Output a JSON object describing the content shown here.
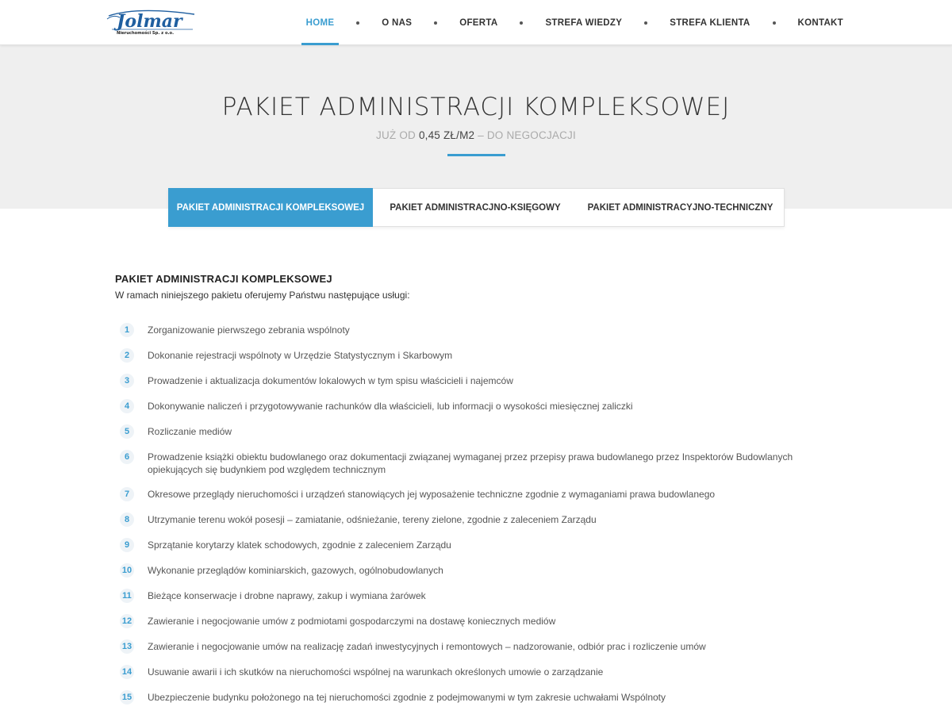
{
  "brand": {
    "name": "Jolmar",
    "tagline": "Nieruchomości Sp. z o.o."
  },
  "nav": {
    "items": [
      "HOME",
      "O NAS",
      "OFERTA",
      "STREFA WIEDZY",
      "STREFA KLIENTA",
      "KONTAKT"
    ],
    "active_index": 0
  },
  "hero": {
    "title": "PAKIET ADMINISTRACJI KOMPLEKSOWEJ",
    "sub_prefix": "JUŻ OD",
    "price": "0,45 ZŁ/M2",
    "sub_suffix": "– DO NEGOCJACJI"
  },
  "tabs": {
    "items": [
      "PAKIET ADMINISTRACJI KOMPLEKSOWEJ",
      "PAKIET ADMINISTRACJNO-KSIĘGOWY",
      "PAKIET ADMINISTRACYJNO-TECHNICZNY"
    ],
    "active_index": 0
  },
  "content": {
    "title": "PAKIET ADMINISTRACJI KOMPLEKSOWEJ",
    "intro": "W ramach niniejszego pakietu oferujemy Państwu następujące usługi:",
    "items": [
      {
        "num": "1",
        "text": "Zorganizowanie pierwszego zebrania wspólnoty"
      },
      {
        "num": "2",
        "text": "Dokonanie rejestracji wspólnoty w Urzędzie Statystycznym i Skarbowym"
      },
      {
        "num": "3",
        "text": "Prowadzenie i aktualizacja dokumentów lokalowych w tym spisu właścicieli i najemców"
      },
      {
        "num": "4",
        "text": "Dokonywanie naliczeń i przygotowywanie rachunków dla właścicieli, lub informacji o wysokości miesięcznej zaliczki"
      },
      {
        "num": "5",
        "text": "Rozliczanie mediów"
      },
      {
        "num": "6",
        "text": "Prowadzenie książki obiektu budowlanego oraz dokumentacji związanej wymaganej przez przepisy prawa budowlanego przez Inspektorów Budowlanych opiekujących się budynkiem pod względem technicznym"
      },
      {
        "num": "7",
        "text": "Okresowe przeglądy nieruchomości i urządzeń stanowiących jej wyposażenie techniczne zgodnie z wymaganiami prawa budowlanego"
      },
      {
        "num": "8",
        "text": "Utrzymanie terenu wokół posesji – zamiatanie, odśnieżanie, tereny zielone, zgodnie z zaleceniem Zarządu"
      },
      {
        "num": "9",
        "text": "Sprzątanie korytarzy klatek schodowych, zgodnie z zaleceniem Zarządu"
      },
      {
        "num": "10",
        "text": "Wykonanie przeglądów kominiarskich, gazowych, ogólnobudowlanych"
      },
      {
        "num": "11",
        "text": "Bieżące konserwacje i drobne naprawy, zakup i wymiana żarówek"
      },
      {
        "num": "12",
        "text": "Zawieranie i negocjowanie umów z podmiotami gospodarczymi na dostawę koniecznych mediów"
      },
      {
        "num": "13",
        "text": "Zawieranie i negocjowanie umów na realizację zadań inwestycyjnych i remontowych – nadzorowanie, odbiór prac i rozliczenie umów"
      },
      {
        "num": "14",
        "text": "Usuwanie awarii i ich skutków na nieruchomości wspólnej na warunkach określonych umowie o zarządzanie"
      },
      {
        "num": "15",
        "text": "Ubezpieczenie budynku położonego na tej nieruchomości zgodnie z podejmowanymi w tym zakresie uchwałami Wspólnoty"
      }
    ]
  },
  "colors": {
    "accent": "#3a9dd0",
    "hero_bg": "#efefef",
    "logo_blue": "#1f5fa0"
  }
}
